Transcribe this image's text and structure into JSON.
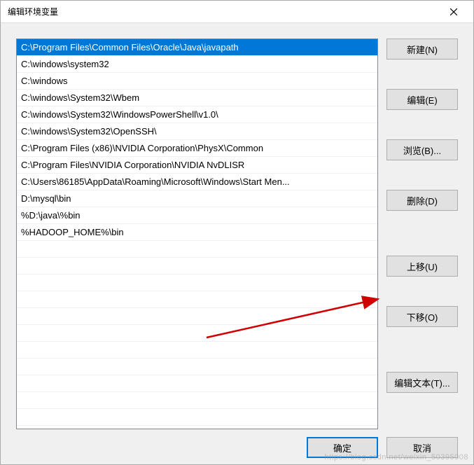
{
  "title": "编辑环境变量",
  "paths": [
    "C:\\Program Files\\Common Files\\Oracle\\Java\\javapath",
    "C:\\windows\\system32",
    "C:\\windows",
    "C:\\windows\\System32\\Wbem",
    "C:\\windows\\System32\\WindowsPowerShell\\v1.0\\",
    "C:\\windows\\System32\\OpenSSH\\",
    "C:\\Program Files (x86)\\NVIDIA Corporation\\PhysX\\Common",
    "C:\\Program Files\\NVIDIA Corporation\\NVIDIA NvDLISR",
    "C:\\Users\\86185\\AppData\\Roaming\\Microsoft\\Windows\\Start Men...",
    "D:\\mysql\\bin",
    "%D:\\java\\%bin",
    "%HADOOP_HOME%\\bin"
  ],
  "selected_index": 0,
  "buttons": {
    "new": "新建(N)",
    "edit": "编辑(E)",
    "browse": "浏览(B)...",
    "delete": "删除(D)",
    "moveup": "上移(U)",
    "movedown": "下移(O)",
    "edittext": "编辑文本(T)...",
    "ok": "确定",
    "cancel": "取消"
  },
  "watermark": "https://blog.csdn.net/weixin_50395008"
}
